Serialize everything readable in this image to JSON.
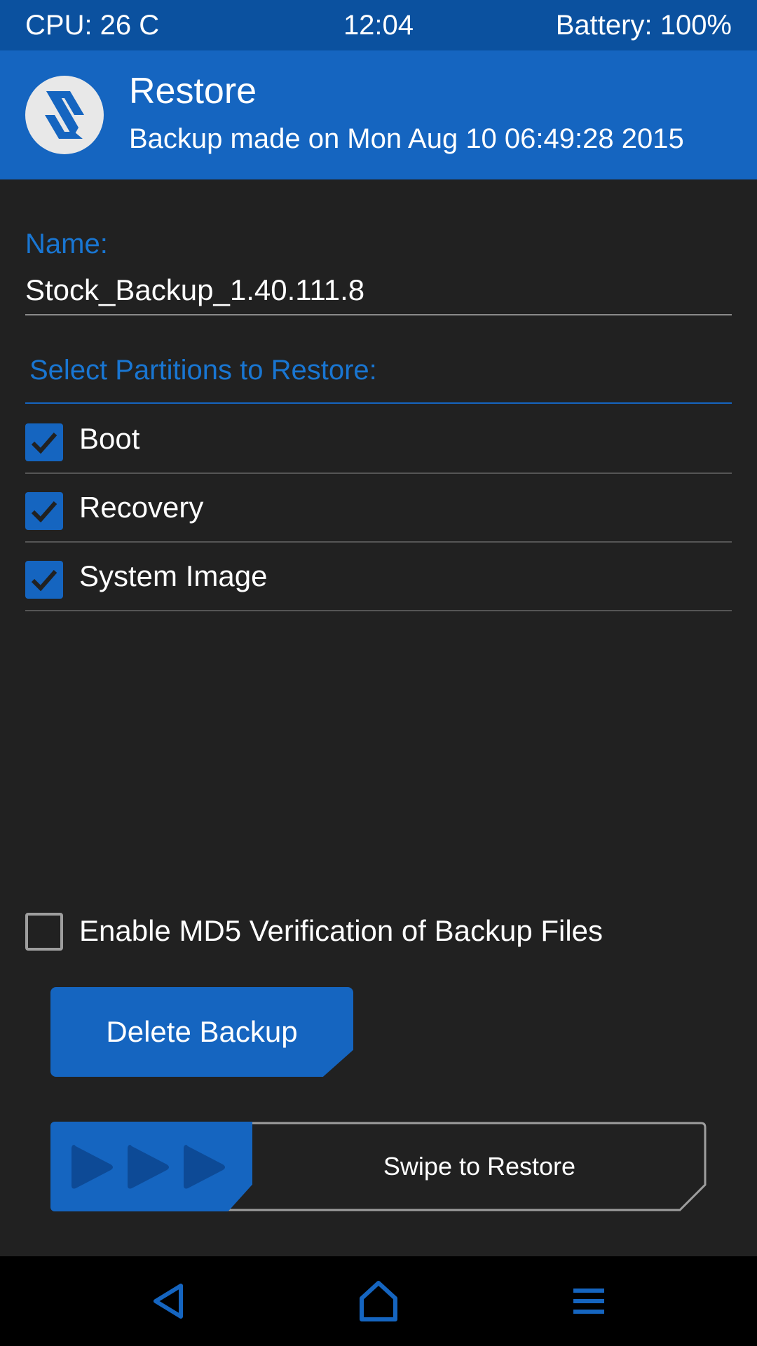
{
  "status_bar": {
    "cpu": "CPU: 26 C",
    "time": "12:04",
    "battery": "Battery: 100%"
  },
  "header": {
    "logo_icon": "twrp-logo-icon",
    "title": "Restore",
    "subtitle": "Backup made on Mon Aug 10 06:49:28 2015"
  },
  "backup_name": {
    "label": "Name:",
    "value": "Stock_Backup_1.40.111.8"
  },
  "partitions": {
    "label": "Select Partitions to Restore:",
    "items": [
      {
        "label": "Boot",
        "checked": true
      },
      {
        "label": "Recovery",
        "checked": true
      },
      {
        "label": "System Image",
        "checked": true
      }
    ]
  },
  "md5": {
    "label": "Enable MD5 Verification of Backup Files",
    "checked": false
  },
  "delete_button": {
    "label": "Delete Backup"
  },
  "swipe": {
    "label": "Swipe to Restore",
    "handle_icon": "triple-arrow-right-icon"
  },
  "nav_bar": {
    "back_icon": "back-icon",
    "home_icon": "home-icon",
    "menu_icon": "menu-icon"
  },
  "colors": {
    "accent": "#1565c0",
    "status_bar": "#0b519f",
    "background": "#212121",
    "label_blue": "#1976d2"
  }
}
